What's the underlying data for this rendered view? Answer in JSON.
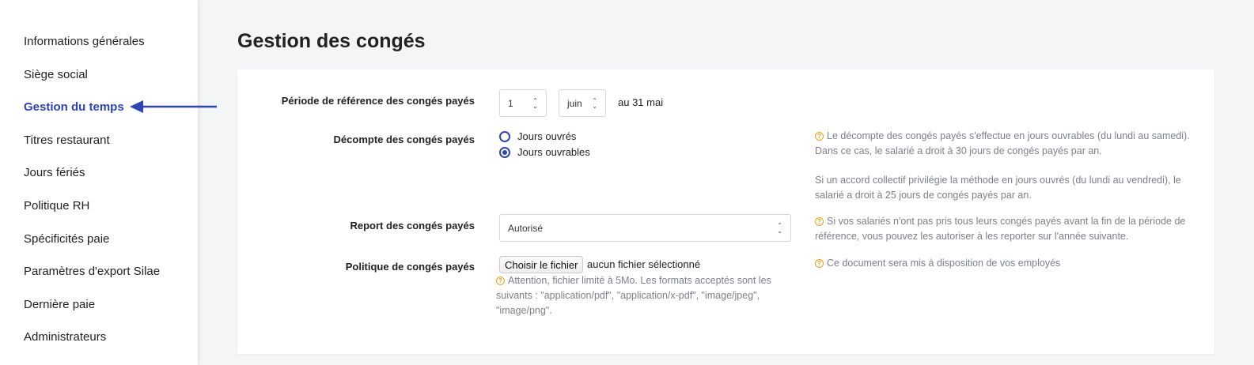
{
  "sidebar": {
    "items": [
      {
        "label": "Informations générales"
      },
      {
        "label": "Siège social"
      },
      {
        "label": "Gestion du temps"
      },
      {
        "label": "Titres restaurant"
      },
      {
        "label": "Jours fériés"
      },
      {
        "label": "Politique RH"
      },
      {
        "label": "Spécificités paie"
      },
      {
        "label": "Paramètres d'export Silae"
      },
      {
        "label": "Dernière paie"
      },
      {
        "label": "Administrateurs"
      }
    ],
    "active_index": 2
  },
  "colors": {
    "accent": "#2b44b6",
    "help_icon": "#e8a21a",
    "help_text": "#7c8088"
  },
  "page": {
    "title": "Gestion des congés"
  },
  "form": {
    "reference_period": {
      "label": "Période de référence des congés payés",
      "day_value": "1",
      "month_value": "juin",
      "suffix": "au 31 mai"
    },
    "count_method": {
      "label": "Décompte des congés payés",
      "options": [
        {
          "label": "Jours ouvrés",
          "checked": false
        },
        {
          "label": "Jours ouvrables",
          "checked": true
        }
      ],
      "help_1": "Le décompte des congés payés s'effectue en jours ouvrables (du lundi au samedi). Dans ce cas, le salarié a droit à 30 jours de congés payés par an.",
      "help_2": "Si un accord collectif privilégie la méthode en jours ouvrés (du lundi au vendredi), le salarié a droit à 25 jours de congés payés par an."
    },
    "carryover": {
      "label": "Report des congés payés",
      "value": "Autorisé",
      "help": "Si vos salariés n'ont pas pris tous leurs congés payés avant la fin de la période de référence, vous pouvez les autoriser à les reporter sur l'année suivante."
    },
    "policy": {
      "label": "Politique de congés payés",
      "button_label": "Choisir le fichier",
      "no_file_text": "aucun fichier sélectionné",
      "warning": "Attention, fichier limité à 5Mo. Les formats acceptés sont les suivants : \"application/pdf\", \"application/x-pdf\", \"image/jpeg\", \"image/png\".",
      "help": "Ce document sera mis à disposition de vos employés"
    }
  },
  "icons": {
    "help": "question-circle-icon",
    "arrow": "arrow-icon",
    "caret": "up-down-caret-icon"
  }
}
